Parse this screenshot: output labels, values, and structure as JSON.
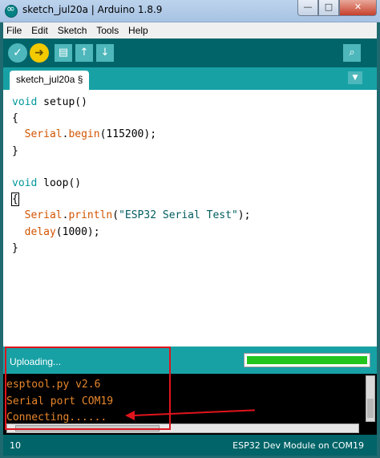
{
  "window": {
    "title": "sketch_jul20a | Arduino 1.8.9",
    "min": "—",
    "max": "□",
    "close": "✕"
  },
  "menu": [
    "File",
    "Edit",
    "Sketch",
    "Tools",
    "Help"
  ],
  "toolbar": {
    "verify_icon": "✓",
    "upload_icon": "➜",
    "new_icon": "▤",
    "open_icon": "↑",
    "save_icon": "↓",
    "monitor_icon": "⌕"
  },
  "tab": {
    "label": "sketch_jul20a §",
    "menu_icon": "▼"
  },
  "code": {
    "l1_kw": "void",
    "l1_rest": " setup()",
    "l2": "{",
    "l3_fn": "Serial",
    "l3_dot": ".",
    "l3_method": "begin",
    "l3_rest": "(115200);",
    "l4": "}",
    "l6_kw": "void",
    "l6_rest": " loop()",
    "l7": "{",
    "l8_fn": "Serial",
    "l8_dot": ".",
    "l8_method": "println",
    "l8_open": "(",
    "l8_str": "\"ESP32 Serial Test\"",
    "l8_close": ");",
    "l9_fn": "delay",
    "l9_rest": "(1000);",
    "l10": "}"
  },
  "status": {
    "message": "Uploading...",
    "progress": 1.0
  },
  "console": {
    "lines": [
      "esptool.py v2.6",
      "Serial port COM19",
      "Connecting......"
    ]
  },
  "bottom": {
    "line_number": "10",
    "board": "ESP32 Dev Module on COM19"
  },
  "colors": {
    "annotation": "#e0141c",
    "toolbar": "#006468",
    "progress_fill": "#22c51d"
  }
}
